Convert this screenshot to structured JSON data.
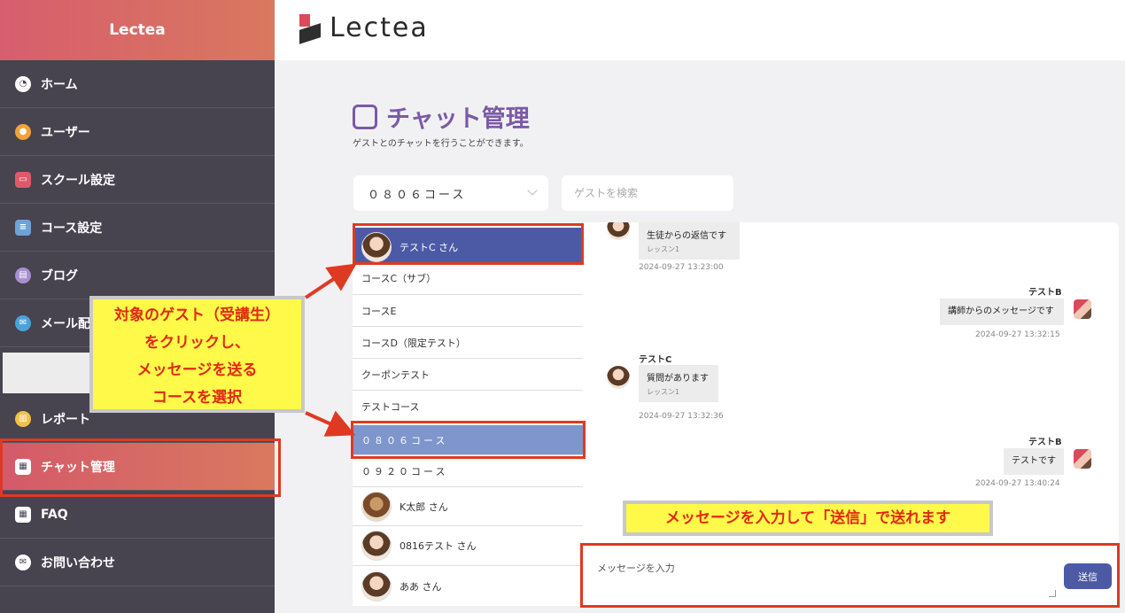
{
  "sidebar": {
    "brand": "Lectea",
    "items": [
      {
        "label": "ホーム",
        "icon": "dashboard-icon"
      },
      {
        "label": "ユーザー",
        "icon": "users-icon"
      },
      {
        "label": "スクール設定",
        "icon": "school-icon"
      },
      {
        "label": "コース設定",
        "icon": "course-icon"
      },
      {
        "label": "ブログ",
        "icon": "blog-icon"
      },
      {
        "label": "メール配",
        "icon": "mail-icon"
      },
      {
        "label": "レポート",
        "icon": "report-icon"
      },
      {
        "label": "チャット管理",
        "icon": "chat-icon"
      },
      {
        "label": "FAQ",
        "icon": "faq-icon"
      },
      {
        "label": "お問い合わせ",
        "icon": "contact-icon"
      }
    ]
  },
  "header": {
    "logo_text": "Lectea"
  },
  "page": {
    "title": "チャット管理",
    "subtitle": "ゲストとのチャットを行うことができます。"
  },
  "controls": {
    "course_select_value": "０８０６コース",
    "search_placeholder": "ゲストを検索"
  },
  "list": {
    "items": [
      {
        "label": "テストC さん",
        "type": "guest",
        "selected": true
      },
      {
        "label": "コースC（サブ）",
        "type": "course"
      },
      {
        "label": "コースE",
        "type": "course"
      },
      {
        "label": "コースD（限定テスト）",
        "type": "course"
      },
      {
        "label": "クーポンテスト",
        "type": "course"
      },
      {
        "label": "テストコース",
        "type": "course"
      },
      {
        "label": "０８０６コース",
        "type": "course",
        "selected": true
      },
      {
        "label": "０９２０コース",
        "type": "course"
      },
      {
        "label": "K太郎 さん",
        "type": "guest"
      },
      {
        "label": "0816テスト さん",
        "type": "guest"
      },
      {
        "label": "ああ さん",
        "type": "guest"
      }
    ]
  },
  "messages": [
    {
      "sender": "",
      "text": "生徒からの返信です",
      "sub": "レッスン1",
      "time": "2024-09-27 13:23:00",
      "side": "left"
    },
    {
      "sender": "テストB",
      "text": "講師からのメッセージです",
      "sub": "",
      "time": "2024-09-27 13:32:15",
      "side": "right"
    },
    {
      "sender": "テストC",
      "text": "質問があります",
      "sub": "レッスン1",
      "time": "2024-09-27 13:32:36",
      "side": "left"
    },
    {
      "sender": "テストB",
      "text": "テストです",
      "sub": "",
      "time": "2024-09-27 13:40:24",
      "side": "right"
    }
  ],
  "composer": {
    "placeholder": "メッセージを入力",
    "send_label": "送信"
  },
  "annotations": {
    "callout1": [
      "対象のゲスト（受講生）",
      "をクリックし、",
      "メッセージを送る",
      "コースを選択"
    ],
    "callout2": "メッセージを入力して「送信」で送れます",
    "accent_red": "#de3a22",
    "callout_yellow": "#fff94a"
  }
}
